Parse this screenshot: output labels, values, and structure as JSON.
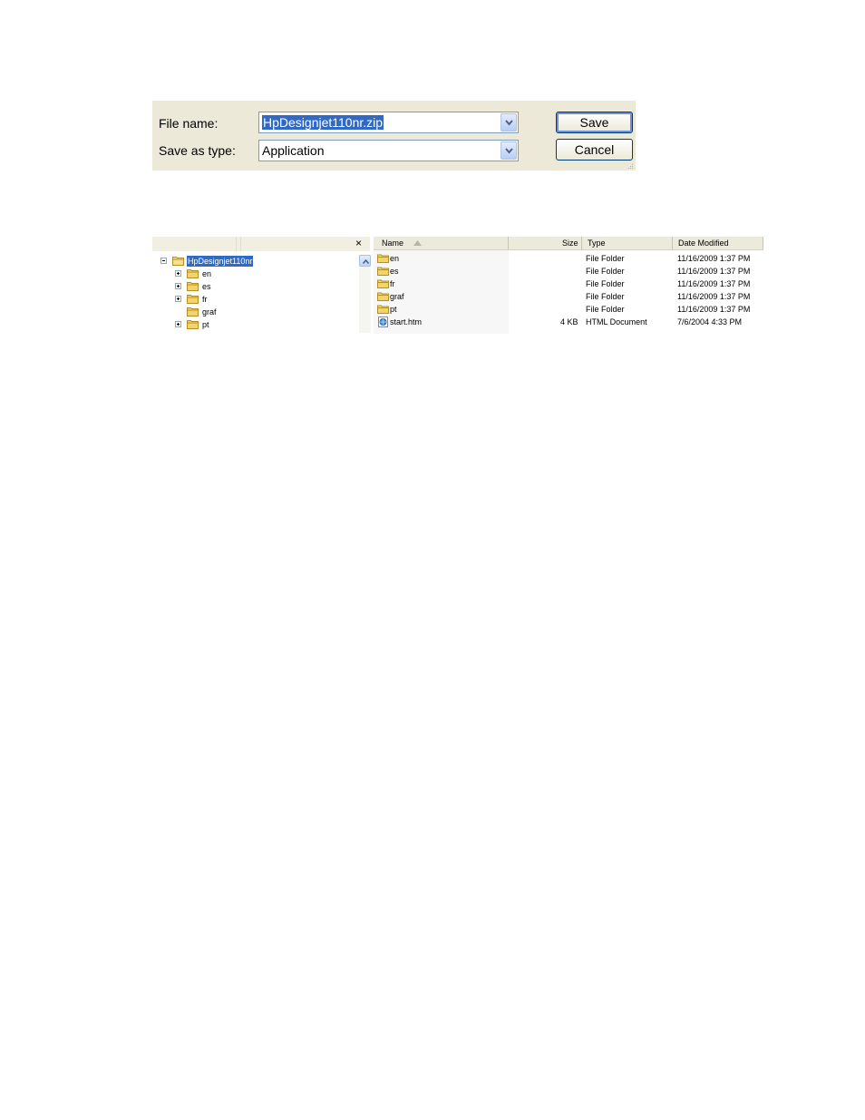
{
  "save_dialog": {
    "file_name_label": "File name:",
    "file_name_value": "HpDesignjet110nr.zip",
    "save_as_type_label": "Save as type:",
    "save_as_type_value": "Application",
    "save_label": "Save",
    "cancel_label": "Cancel"
  },
  "folder_tree": {
    "close_glyph": "×",
    "nodes": [
      {
        "label": "HpDesignjet110nr",
        "expander": "minus",
        "selected": true
      },
      {
        "label": "en",
        "expander": "plus"
      },
      {
        "label": "es",
        "expander": "plus"
      },
      {
        "label": "fr",
        "expander": "plus"
      },
      {
        "label": "graf",
        "expander": "none"
      },
      {
        "label": "pt",
        "expander": "plus"
      }
    ]
  },
  "file_list": {
    "columns": {
      "name": "Name",
      "size": "Size",
      "type": "Type",
      "date": "Date Modified"
    },
    "rows": [
      {
        "name": "en",
        "size": "",
        "type": "File Folder",
        "date": "11/16/2009 1:37 PM",
        "icon": "folder-icon"
      },
      {
        "name": "es",
        "size": "",
        "type": "File Folder",
        "date": "11/16/2009 1:37 PM",
        "icon": "folder-icon"
      },
      {
        "name": "fr",
        "size": "",
        "type": "File Folder",
        "date": "11/16/2009 1:37 PM",
        "icon": "folder-icon"
      },
      {
        "name": "graf",
        "size": "",
        "type": "File Folder",
        "date": "11/16/2009 1:37 PM",
        "icon": "folder-icon"
      },
      {
        "name": "pt",
        "size": "",
        "type": "File Folder",
        "date": "11/16/2009 1:37 PM",
        "icon": "folder-icon"
      },
      {
        "name": "start.htm",
        "size": "4 KB",
        "type": "HTML Document",
        "date": "7/6/2004 4:33 PM",
        "icon": "html-document-icon"
      }
    ]
  },
  "colors": {
    "selection": "#316ac5",
    "dialog_bg": "#ece9d8",
    "folder": "#f3d46a"
  }
}
